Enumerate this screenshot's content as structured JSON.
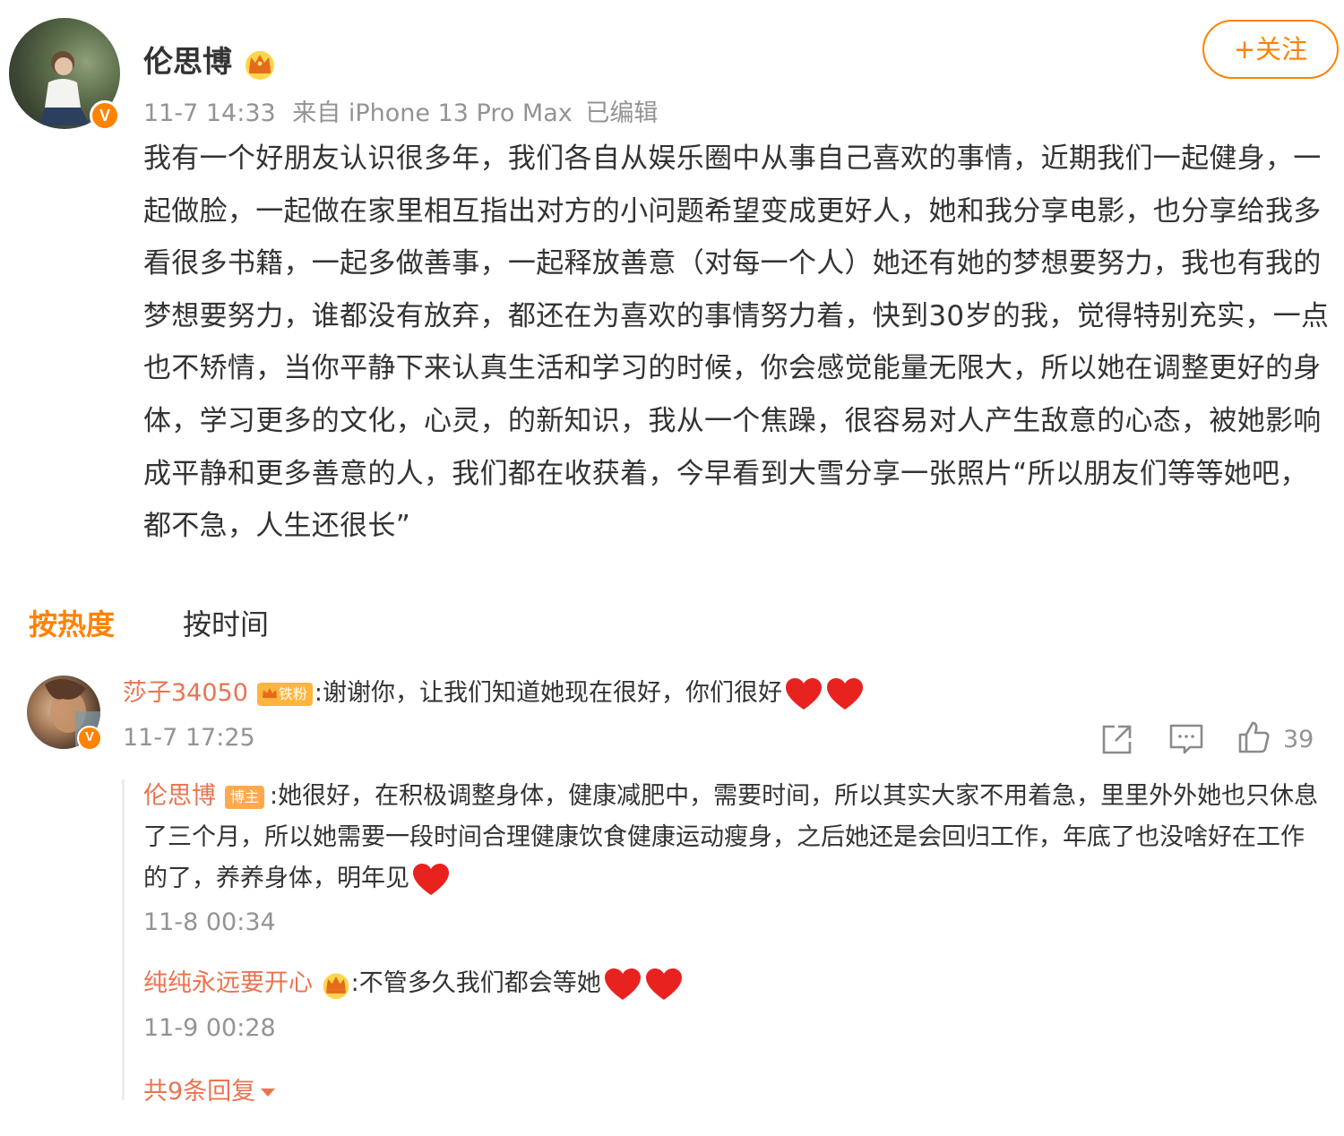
{
  "post": {
    "author": "伦思博",
    "verified_badge": "V",
    "time": "11-7 14:33",
    "source": "来自 iPhone 13 Pro Max",
    "edited": "已编辑",
    "follow_label": "+关注",
    "body": "我有一个好朋友认识很多年，我们各自从娱乐圈中从事自己喜欢的事情，近期我们一起健身，一起做脸，一起做在家里相互指出对方的小问题希望变成更好人，她和我分享电影，也分享给我多看很多书籍，一起多做善事，一起释放善意（对每一个人）她还有她的梦想要努力，我也有我的梦想要努力，谁都没有放弃，都还在为喜欢的事情努力着，快到30岁的我，觉得特别充实，一点也不矫情，当你平静下来认真生活和学习的时候，你会感觉能量无限大，所以她在调整更好的身体，学习更多的文化，心灵，的新知识，我从一个焦躁，很容易对人产生敌意的心态，被她影响成平静和更多善意的人，我们都在收获着，今早看到大雪分享一张照片“所以朋友们等等她吧，都不急，人生还很长”"
  },
  "sort_tabs": {
    "hot": "按热度",
    "time": "按时间",
    "active": "hot"
  },
  "comment": {
    "user": "莎子34050",
    "fan_badge": "铁粉",
    "text": ":谢谢你，让我们知道她现在很好，你们很好",
    "time": "11-7 17:25",
    "like_count": "39",
    "verified_badge": "V"
  },
  "replies": [
    {
      "user": "伦思博",
      "badge": "博主",
      "text": ":她很好，在积极调整身体，健康减肥中，需要时间，所以其实大家不用着急，里里外外她也只休息了三个月，所以她需要一段时间合理健康饮食健康运动瘦身，之后她还是会回归工作，年底了也没啥好在工作的了，养养身体，明年见",
      "time": "11-8 00:34"
    },
    {
      "user": "纯纯永远要开心",
      "text": ":不管多久我们都会等她",
      "time": "11-9 00:28"
    }
  ],
  "more_replies": "共9条回复",
  "colors": {
    "accent": "#ff8200",
    "username": "#eb7350",
    "meta": "#939393",
    "heart": "#e8231f"
  },
  "icons": [
    "crown-icon",
    "verified-icon",
    "heart-icon",
    "share-icon",
    "comment-icon",
    "like-icon",
    "caret-down-icon"
  ]
}
